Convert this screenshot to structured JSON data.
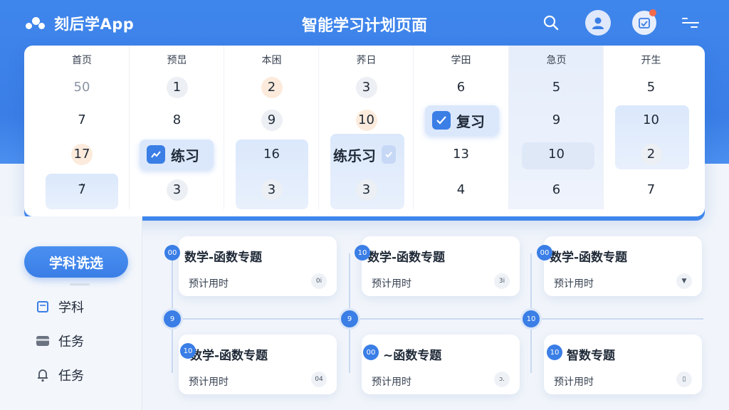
{
  "app": {
    "name": "刻后学App",
    "page_title": "智能学习计划页面"
  },
  "header_icons": [
    "search-icon",
    "user-avatar-icon",
    "calendar-notification-icon",
    "menu-icon"
  ],
  "colors": {
    "primary": "#3a7ee6",
    "peach": "#fcebdc",
    "notification": "#f36b4c"
  },
  "calendar": {
    "columns": [
      {
        "head": "首页",
        "cells": [
          "50",
          "7",
          "17",
          "7̃"
        ]
      },
      {
        "head": "预旵",
        "cells": [
          "1",
          "8",
          "练习",
          "3"
        ]
      },
      {
        "head": "本困",
        "cells": [
          "2",
          "9",
          "16",
          "3"
        ]
      },
      {
        "head": "荞日",
        "cells": [
          "3",
          "10",
          "练习",
          "3"
        ]
      },
      {
        "head": "学田",
        "cells": [
          "6",
          "复习",
          "13",
          "4"
        ]
      },
      {
        "head": "急页",
        "cells": [
          "5",
          "9",
          "10",
          "6"
        ]
      },
      {
        "head": "开生",
        "cells": [
          "5",
          "10",
          "2",
          "7"
        ]
      }
    ],
    "chips": {
      "practice_1": "练习",
      "practice_2": "练乐习",
      "review": "复习"
    }
  },
  "sidebar": {
    "filter_button": "学科诜选",
    "items": [
      {
        "label": "学科",
        "icon": "book-icon"
      },
      {
        "label": "任务",
        "icon": "folder-icon"
      },
      {
        "label": "任务",
        "icon": "bell-icon"
      }
    ]
  },
  "timeline": {
    "markers": [
      "9",
      "9",
      "10"
    ]
  },
  "tasks": [
    {
      "dot": "00",
      "title": "数学-函数专题",
      "sub": "预计用时",
      "badge": "0i"
    },
    {
      "dot": "10",
      "title": "数学-函数专题",
      "sub": "预计用时",
      "badge": "3i"
    },
    {
      "dot": "00",
      "title": "数学-函数专题",
      "sub": "预计用时",
      "badge": "▼"
    },
    {
      "dot": "10",
      "title": "数学-函数专题",
      "sub": "预计用时",
      "badge": "04"
    },
    {
      "dot": "00",
      "title": "~函数专题",
      "sub": "预计用时",
      "badge": "ɔ."
    },
    {
      "dot": "10",
      "title": "智数专题",
      "sub": "预计用时",
      "badge": "▯"
    }
  ]
}
